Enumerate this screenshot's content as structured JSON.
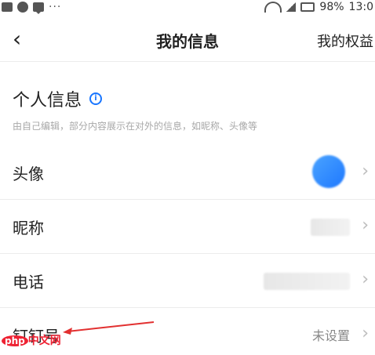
{
  "status_bar": {
    "battery": "98%",
    "time": "13:0"
  },
  "nav": {
    "back_icon": "chevron-left-icon",
    "title": "我的信息",
    "right_label": "我的权益"
  },
  "section": {
    "title": "个人信息",
    "description": "由自己编辑，部分内容展示在对外的信息，如昵称、头像等"
  },
  "rows": [
    {
      "label": "头像",
      "value": ""
    },
    {
      "label": "昵称",
      "value": ""
    },
    {
      "label": "电话",
      "value": ""
    },
    {
      "label": "钉钉号",
      "value": "未设置"
    }
  ],
  "watermark": {
    "text": "php中文网",
    "prefix": "php",
    "suffix": "中文网"
  },
  "colors": {
    "accent": "#1976ff",
    "annotation": "#e23030"
  }
}
